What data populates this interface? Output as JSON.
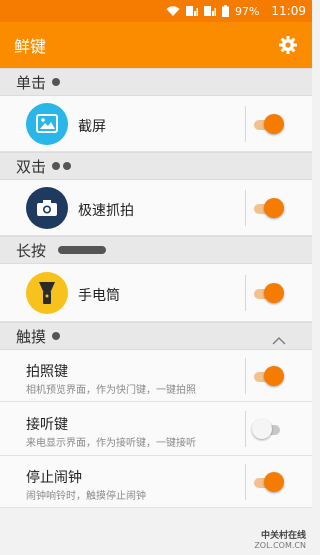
{
  "status": {
    "battery": "97%",
    "time": "11:09"
  },
  "app": {
    "title": "鲜键"
  },
  "sections": {
    "single": {
      "label": "单击"
    },
    "double": {
      "label": "双击"
    },
    "long": {
      "label": "长按"
    },
    "touch": {
      "label": "触摸"
    }
  },
  "actions": {
    "screenshot": {
      "label": "截屏",
      "enabled": true
    },
    "camera": {
      "label": "极速抓拍",
      "enabled": true
    },
    "flashlight": {
      "label": "手电筒",
      "enabled": true
    }
  },
  "touch_settings": [
    {
      "title": "拍照键",
      "subtitle": "相机预览界面，作为快门键，一键拍照",
      "enabled": true
    },
    {
      "title": "接听键",
      "subtitle": "来电显示界面，作为接听键，一键接听",
      "enabled": false
    },
    {
      "title": "停止闹钟",
      "subtitle": "闹钟响铃时，触摸停止闹钟",
      "enabled": true
    }
  ],
  "watermark": {
    "brand": "中关村在线",
    "site": "ZOL.COM.CN"
  },
  "colors": {
    "accent": "#fb8c00",
    "toggle_on": "#f57c00",
    "camera_bg": "#1e3a5f",
    "flash_bg": "#f7c21b",
    "screenshot_bg": "#29b6e8"
  }
}
